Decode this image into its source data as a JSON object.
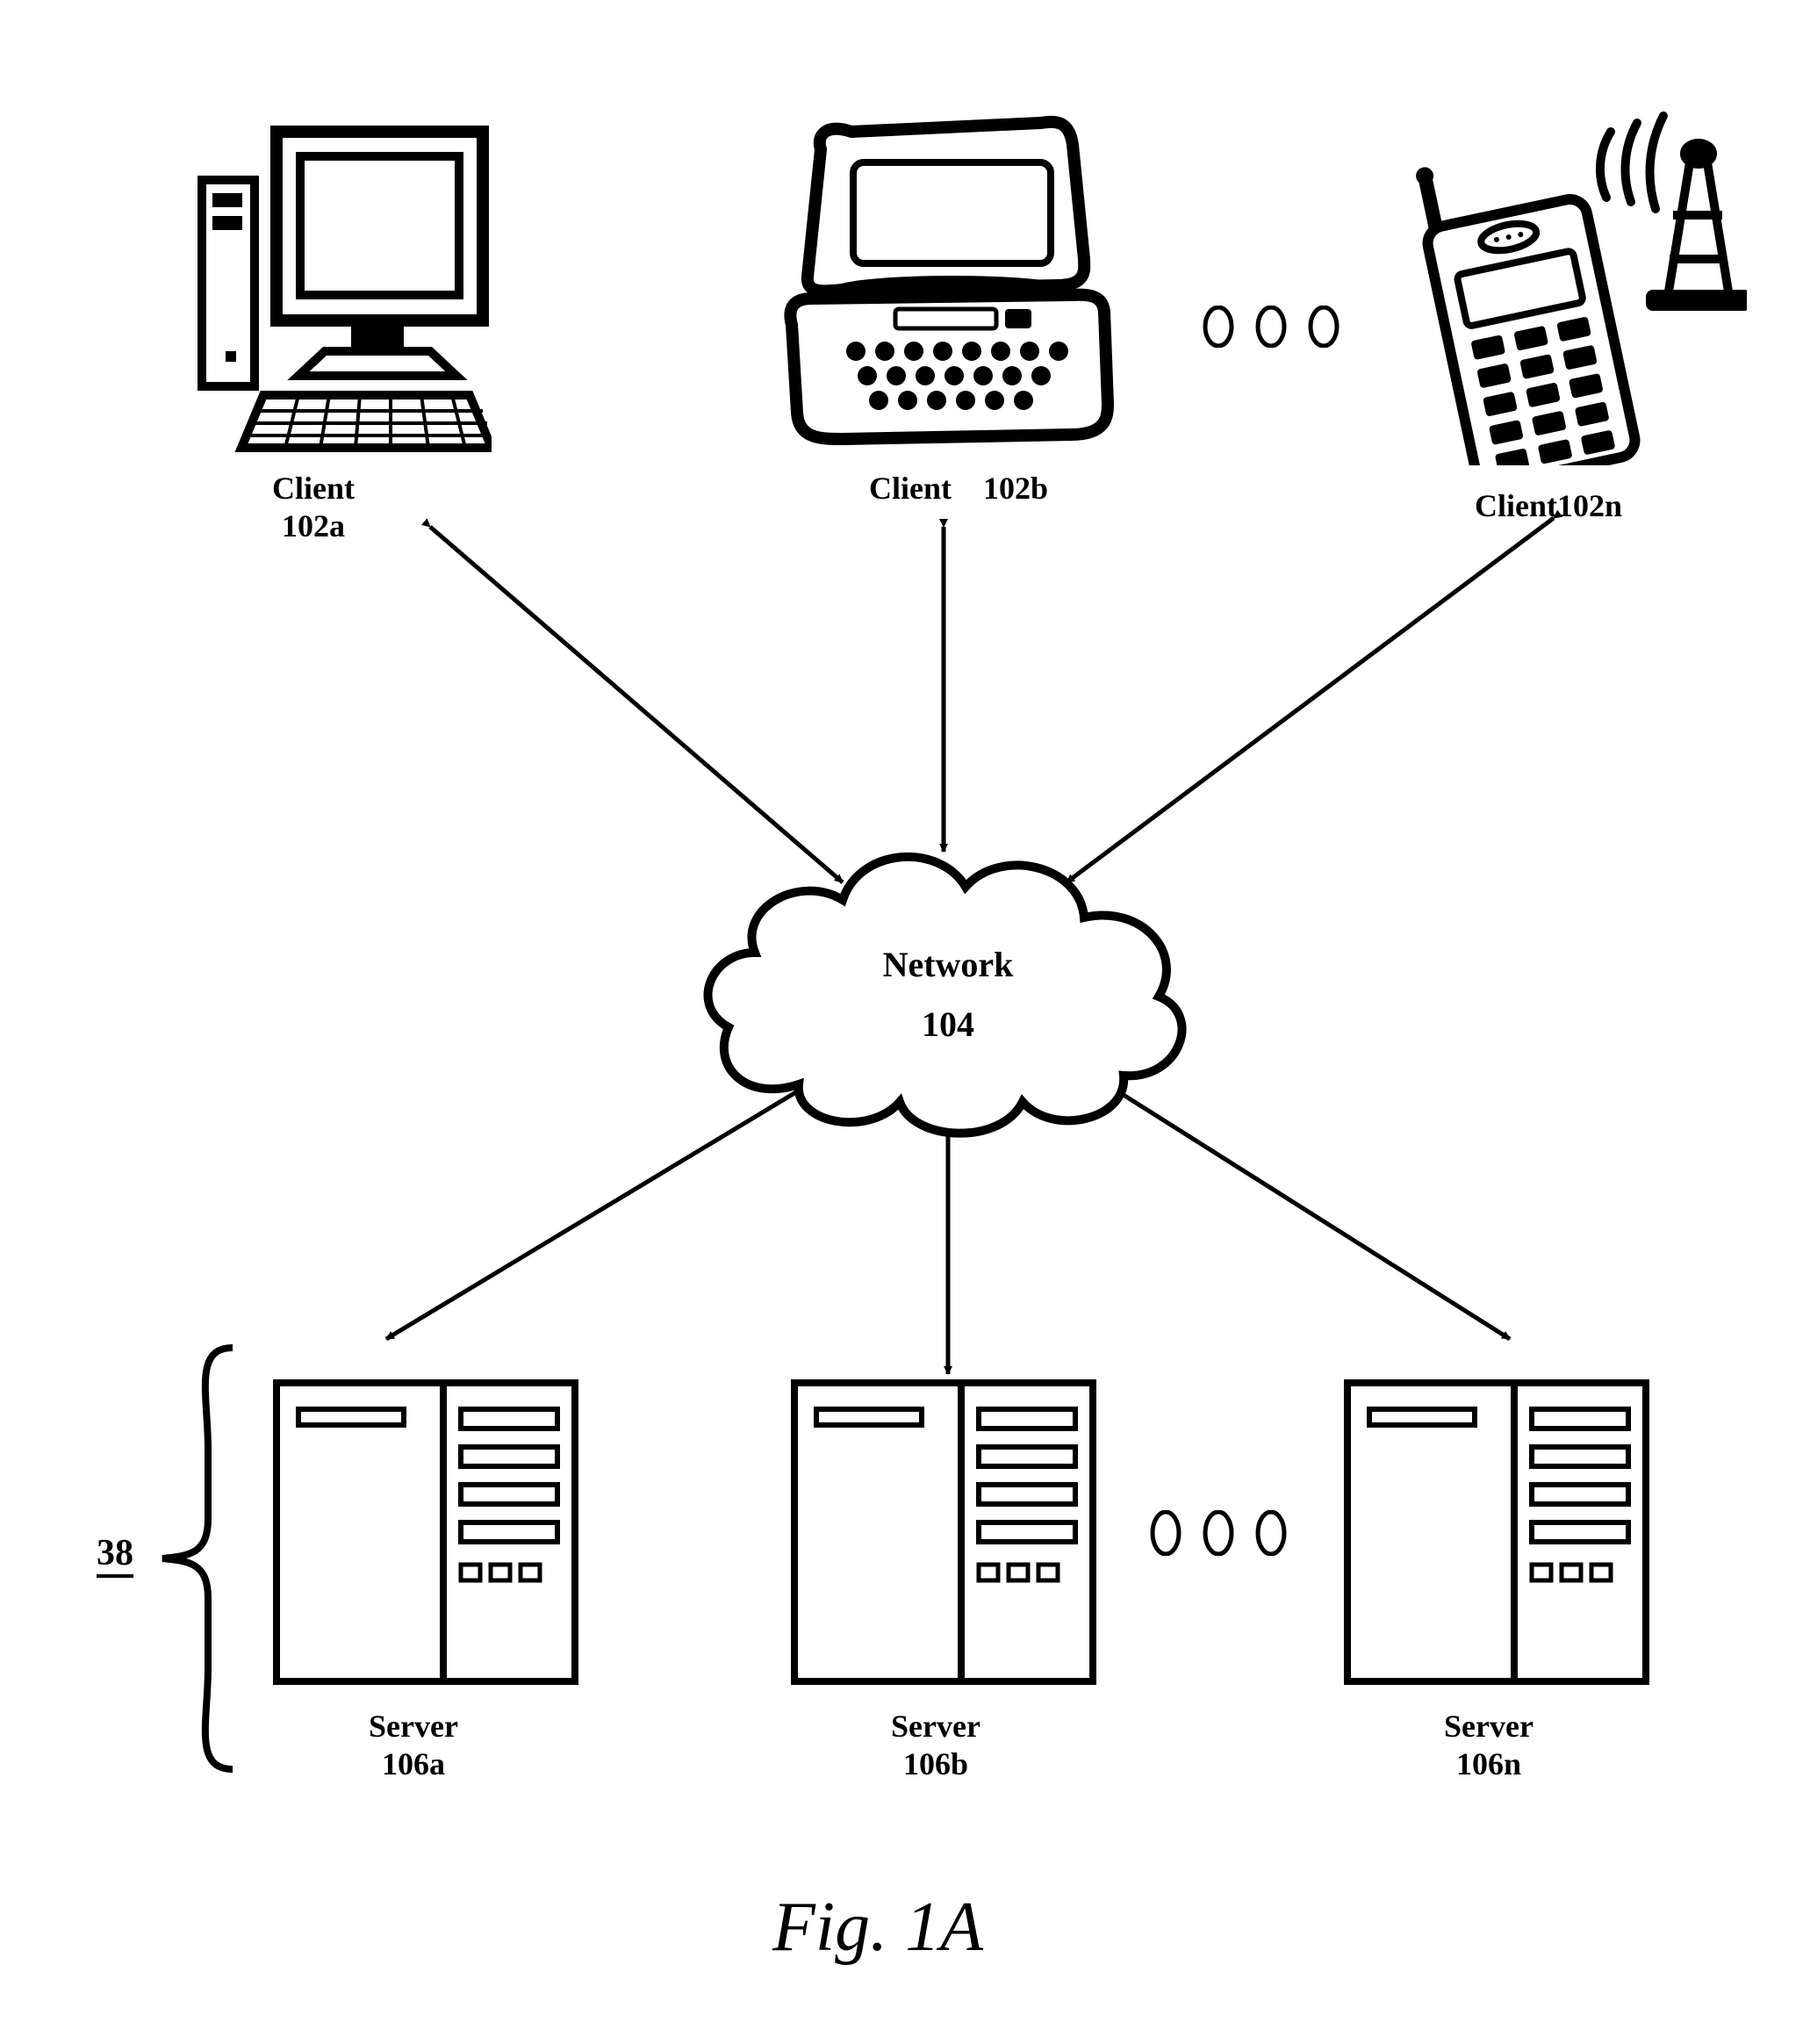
{
  "nodes": {
    "clientA": {
      "label": "Client",
      "ref": "102a"
    },
    "clientB": {
      "label": "Client",
      "ref": "102b"
    },
    "clientN": {
      "label": "Client",
      "ref": "102n"
    },
    "serverA": {
      "label": "Server",
      "ref": "106a"
    },
    "serverB": {
      "label": "Server",
      "ref": "106b"
    },
    "serverN": {
      "label": "Server",
      "ref": "106n"
    }
  },
  "network": {
    "label": "Network",
    "ref": "104"
  },
  "server_farm_ref": "38",
  "figure_caption": "Fig. 1A"
}
